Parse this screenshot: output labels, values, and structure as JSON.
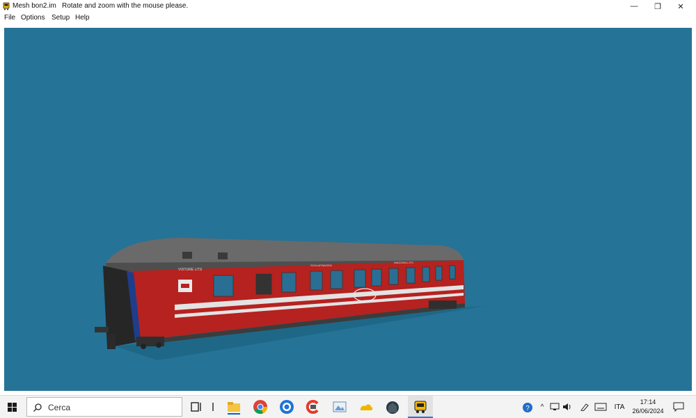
{
  "window": {
    "title": "Mesh bon2.im",
    "message": "Rotate and zoom with the mouse please.",
    "minimize_glyph": "—",
    "restore_glyph": "❐",
    "close_glyph": "✕"
  },
  "menu": [
    "File",
    "Options",
    "Setup",
    "Help"
  ],
  "viewport": {
    "background_color": "#257397",
    "model": {
      "type": "railway sleeping car",
      "body_color": "#b5221f",
      "roof_color": "#5e5e5e",
      "side_text_1": "VOITURE LITS",
      "side_text_2": "SCHLAFWAGEN",
      "side_text_3": "WAGONS-LITS"
    }
  },
  "taskbar": {
    "search_placeholder": "Cerca",
    "apps": [
      "task-view-icon",
      "file-explorer-icon",
      "chrome-icon",
      "firefox-icon",
      "ccleaner-icon",
      "image-viewer-icon",
      "onedrive-icon",
      "steam-icon",
      "mesh-viewer-icon"
    ],
    "language": "ITA",
    "time": "17:14",
    "date": "26/06/2024"
  }
}
